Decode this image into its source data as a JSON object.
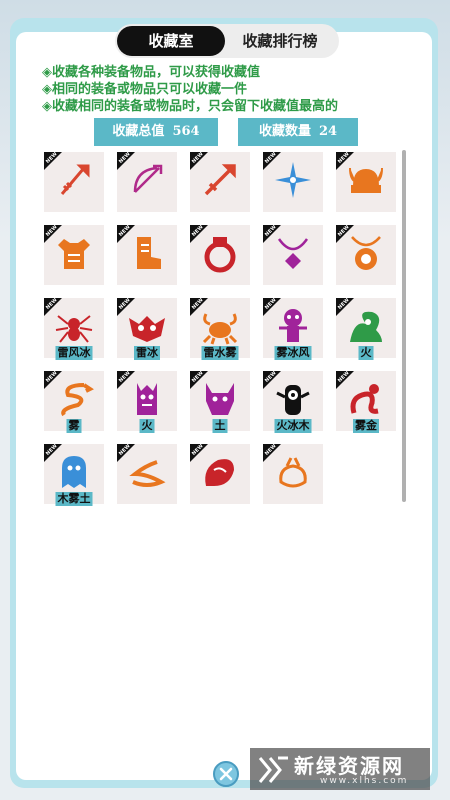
{
  "tabs": [
    {
      "label": "收藏室",
      "active": true
    },
    {
      "label": "收藏排行榜",
      "active": false
    }
  ],
  "rules": [
    "◈收藏各种装备物品，可以获得收藏值",
    "◈相同的装备或物品只可以收藏一件",
    "◈收藏相同的装备或物品时，只会留下收藏值最高的"
  ],
  "stats": {
    "total_label": "收藏总值",
    "total_value": "564",
    "count_label": "收藏数量",
    "count_value": "24"
  },
  "new_badge": "NEW",
  "items": [
    {
      "icon": "spear-icon",
      "color": "#d9462f",
      "label": ""
    },
    {
      "icon": "bow-icon",
      "color": "#b02a8a",
      "label": ""
    },
    {
      "icon": "sword-icon",
      "color": "#d9462f",
      "label": ""
    },
    {
      "icon": "shuriken-icon",
      "color": "#3a8fd8",
      "label": ""
    },
    {
      "icon": "viking-helmet-icon",
      "color": "#e8761f",
      "label": ""
    },
    {
      "icon": "armor-icon",
      "color": "#e8761f",
      "label": ""
    },
    {
      "icon": "boots-icon",
      "color": "#e8761f",
      "label": ""
    },
    {
      "icon": "ring-icon",
      "color": "#c8242a",
      "label": ""
    },
    {
      "icon": "amulet-icon",
      "color": "#a0239a",
      "label": ""
    },
    {
      "icon": "pendant-icon",
      "color": "#e8761f",
      "label": ""
    },
    {
      "icon": "spider-icon",
      "color": "#c8242a",
      "label": "雷风冰"
    },
    {
      "icon": "bat-mask-icon",
      "color": "#c8242a",
      "label": "雷冰"
    },
    {
      "icon": "crab-icon",
      "color": "#e8761f",
      "label": "雷水雾"
    },
    {
      "icon": "skull-totem-icon",
      "color": "#a0239a",
      "label": "雾冰风"
    },
    {
      "icon": "plant-monster-icon",
      "color": "#2f9b48",
      "label": "火"
    },
    {
      "icon": "dragon-icon",
      "color": "#e8761f",
      "label": "雾"
    },
    {
      "icon": "tree-monster-icon",
      "color": "#a0239a",
      "label": "火"
    },
    {
      "icon": "demon-icon",
      "color": "#a0239a",
      "label": "土"
    },
    {
      "icon": "cyclops-icon",
      "color": "#111111",
      "label": "火冰木"
    },
    {
      "icon": "serpent-rider-icon",
      "color": "#c8242a",
      "label": "雾金"
    },
    {
      "icon": "ghost-icon",
      "color": "#3a8fd8",
      "label": "木雾土"
    },
    {
      "icon": "rope-icon",
      "color": "#e8761f",
      "label": ""
    },
    {
      "icon": "meat-icon",
      "color": "#c8242a",
      "label": ""
    },
    {
      "icon": "bag-icon",
      "color": "#e8761f",
      "label": ""
    }
  ],
  "watermark": {
    "name": "新绿资源网",
    "url": "www.xlhs.com"
  }
}
